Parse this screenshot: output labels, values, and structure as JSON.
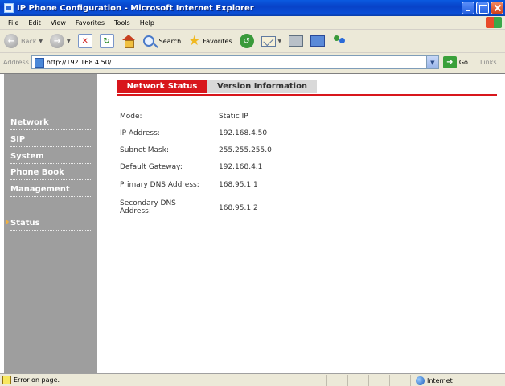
{
  "window": {
    "title": "IP Phone Configuration - Microsoft Internet Explorer"
  },
  "menu": {
    "items": [
      "File",
      "Edit",
      "View",
      "Favorites",
      "Tools",
      "Help"
    ]
  },
  "toolbar": {
    "back_label": "Back",
    "search_label": "Search",
    "favorites_label": "Favorites"
  },
  "address": {
    "label": "Address",
    "url": "http://192.168.4.50/",
    "go_label": "Go",
    "links_label": "Links"
  },
  "sidebar": {
    "items": [
      {
        "label": "Network",
        "active": false
      },
      {
        "label": "SIP",
        "active": false
      },
      {
        "label": "System",
        "active": false
      },
      {
        "label": "Phone Book",
        "active": false
      },
      {
        "label": "Management",
        "active": false
      },
      {
        "label": "Status",
        "active": true
      }
    ]
  },
  "tabs": [
    {
      "label": "Network Status",
      "active": true
    },
    {
      "label": "Version Information",
      "active": false
    }
  ],
  "network_status": {
    "rows": [
      {
        "label": "Mode:",
        "value": "Static IP"
      },
      {
        "label": "IP Address:",
        "value": "192.168.4.50"
      },
      {
        "label": "Subnet Mask:",
        "value": "255.255.255.0"
      },
      {
        "label": "Default Gateway:",
        "value": "192.168.4.1"
      },
      {
        "label": "Primary DNS Address:",
        "value": "168.95.1.1"
      },
      {
        "label": "Secondary DNS Address:",
        "value": "168.95.1.2"
      }
    ]
  },
  "statusbar": {
    "message": "Error on page.",
    "zone": "Internet"
  },
  "colors": {
    "accent": "#d8161c",
    "sidebar": "#9e9e9e",
    "titlebar": "#0842c8"
  }
}
